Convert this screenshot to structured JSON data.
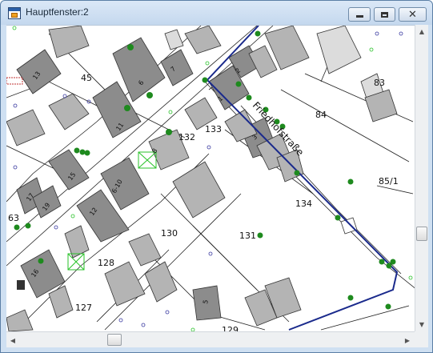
{
  "window": {
    "title": "Hauptfenster:2",
    "app_icon": "app-window-icon",
    "buttons": {
      "minimize": "minimize-icon",
      "maximize": "maximize-icon",
      "close_glyph": "✕"
    }
  },
  "colors": {
    "building": "#b4b4b4",
    "building_dark": "#8c8c8c",
    "building_light": "#dcdcdc",
    "parcel_line": "#222222",
    "highlight_boundary": "#1a2a8c",
    "tree": "#1e8a1e",
    "marker": "#3a3aa0",
    "survey_cross": "#29c229",
    "background": "#ffffff"
  },
  "map": {
    "street_name": "Friedhofstraße",
    "parcel_numbers": [
      "45",
      "83",
      "84",
      "133",
      "132",
      "85/1",
      "134",
      "63",
      "130",
      "131",
      "128",
      "127",
      "129"
    ],
    "house_numbers": [
      "13",
      "2",
      "7",
      "6",
      "1",
      "11",
      "3",
      "8",
      "15",
      "17",
      "19",
      "6-10",
      "12",
      "16",
      "5"
    ]
  },
  "scrollbars": {
    "vertical": {
      "up_arrow": "▲",
      "down_arrow": "▼"
    },
    "horizontal": {
      "left_arrow": "◀",
      "right_arrow": "▶"
    }
  }
}
